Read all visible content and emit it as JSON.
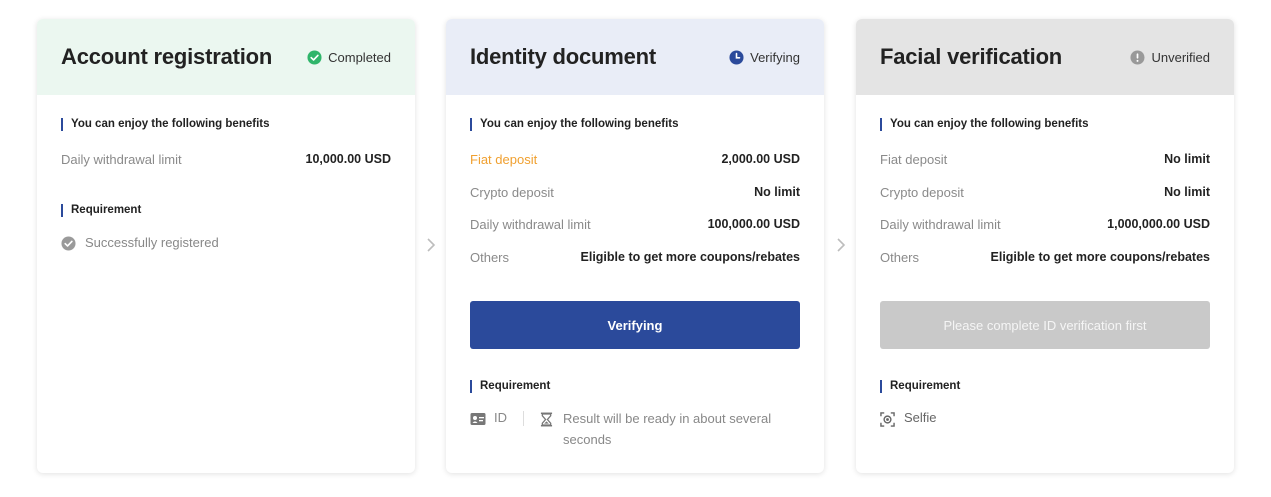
{
  "cards": [
    {
      "title": "Account registration",
      "status": "Completed",
      "status_color": "#2fb56a",
      "benefits_label": "You can enjoy the following benefits",
      "benefits": [
        {
          "label": "Daily withdrawal limit",
          "value": "10,000.00 USD"
        }
      ],
      "requirement_label": "Requirement",
      "requirement_text": "Successfully registered"
    },
    {
      "title": "Identity document",
      "status": "Verifying",
      "status_color": "#2b4a9b",
      "benefits_label": "You can enjoy the following benefits",
      "benefits": [
        {
          "label": "Fiat deposit",
          "value": "2,000.00 USD"
        },
        {
          "label": "Crypto deposit",
          "value": "No limit"
        },
        {
          "label": "Daily withdrawal limit",
          "value": "100,000.00 USD"
        },
        {
          "label": "Others",
          "value": "Eligible to get more coupons/rebates"
        }
      ],
      "button_label": "Verifying",
      "requirement_label": "Requirement",
      "requirement_id": "ID",
      "requirement_note": "Result will be ready in about several seconds"
    },
    {
      "title": "Facial verification",
      "status": "Unverified",
      "status_color": "#999999",
      "benefits_label": "You can enjoy the following benefits",
      "benefits": [
        {
          "label": "Fiat deposit",
          "value": "No limit"
        },
        {
          "label": "Crypto deposit",
          "value": "No limit"
        },
        {
          "label": "Daily withdrawal limit",
          "value": "1,000,000.00 USD"
        },
        {
          "label": "Others",
          "value": "Eligible to get more coupons/rebates"
        }
      ],
      "button_label": "Please complete ID verification first",
      "requirement_label": "Requirement",
      "requirement_text": "Selfie"
    }
  ],
  "colors": {
    "accent": "#2b4a9b",
    "highlight": "#f0a030",
    "completed": "#2fb56a"
  }
}
